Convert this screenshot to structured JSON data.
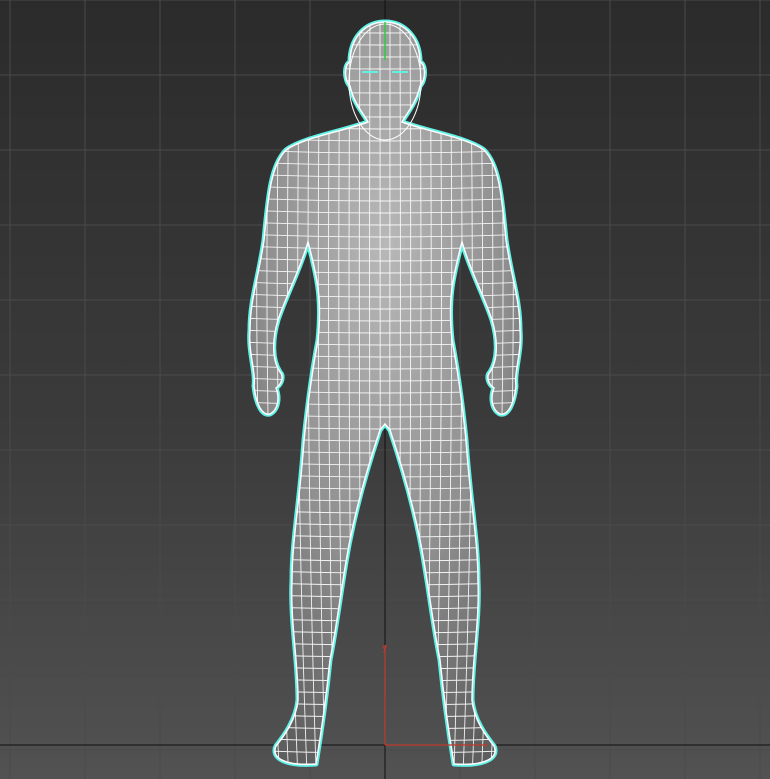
{
  "viewport": {
    "view": "Front",
    "background_colors": [
      "#2b2b2b",
      "#3b3b3b",
      "#525252"
    ],
    "grid_color": "#4a4a4a",
    "axis_color": "#111111"
  },
  "model": {
    "object": "character-mesh",
    "shading": "smooth-with-wireframe",
    "selected": true,
    "selection_outline_color": "#5ff0e6",
    "surface_color": "#8e8e8e",
    "wireframe_color": "#ffffff"
  },
  "gizmo": {
    "type": "transform",
    "x_axis_color": "#c0392b",
    "y_axis_color": "#c0392b",
    "z_axis_color": "#2ecc40"
  }
}
